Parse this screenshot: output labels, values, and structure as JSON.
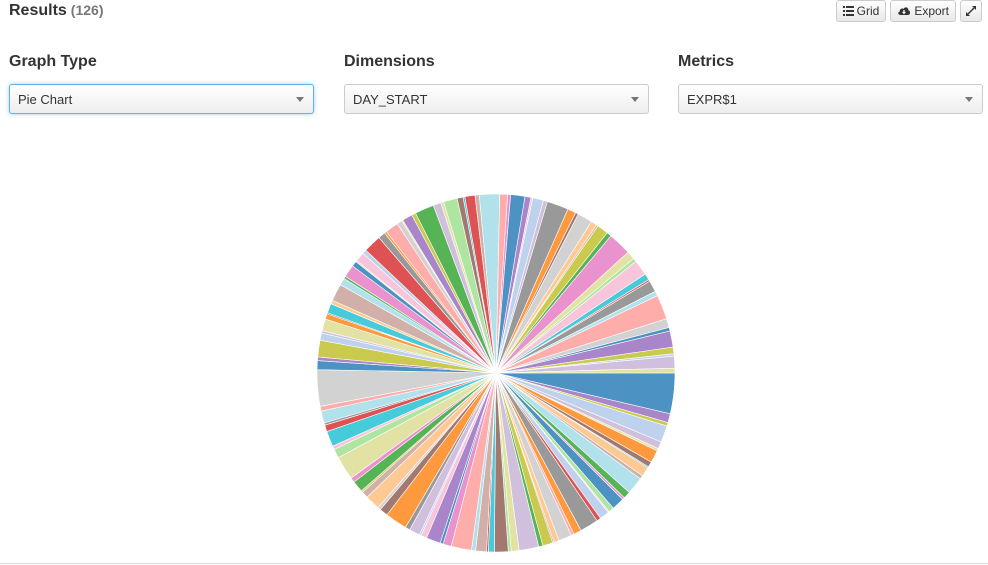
{
  "header": {
    "title": "Results",
    "count": "(126)"
  },
  "toolbar": {
    "grid_label": "Grid",
    "export_label": "Export",
    "grid_icon": "list-icon",
    "export_icon": "cloud-download-icon",
    "expand_icon": "expand-icon"
  },
  "controls": {
    "graph_type": {
      "label": "Graph Type",
      "value": "Pie Chart"
    },
    "dimensions": {
      "label": "Dimensions",
      "value": "DAY_START"
    },
    "metrics": {
      "label": "Metrics",
      "value": "EXPR$1"
    }
  },
  "colors": {
    "active_border": "#66afe9"
  },
  "chart_data": {
    "type": "pie",
    "slice_count": 126,
    "palette": [
      "#1f77b4",
      "#aec7e8",
      "#ff7f0e",
      "#ffbb78",
      "#2ca02c",
      "#98df8a",
      "#d62728",
      "#ff9896",
      "#9467bd",
      "#c5b0d5",
      "#8c564b",
      "#c49c94",
      "#e377c2",
      "#f7b6d2",
      "#7f7f7f",
      "#c7c7c7",
      "#bcbd22",
      "#dbdb8d",
      "#17becf",
      "#9edae5"
    ],
    "values": [
      6.8,
      6.1,
      4.1,
      4.0,
      3.9,
      3.7,
      3.6,
      3.4,
      3.4,
      3.3,
      3.2,
      3.1,
      3.0,
      2.9,
      2.9,
      2.8,
      2.8,
      2.7,
      2.6,
      2.6,
      2.5,
      2.5,
      2.4,
      2.4,
      2.3,
      2.3,
      2.2,
      2.2,
      2.1,
      2.1,
      2.1,
      2.0,
      2.0,
      2.0,
      1.9,
      1.9,
      1.9,
      1.8,
      1.8,
      1.8,
      1.7,
      1.7,
      1.7,
      1.6,
      1.6,
      1.6,
      1.6,
      1.5,
      1.5,
      1.5,
      1.5,
      1.4,
      1.4,
      1.4,
      1.4,
      1.3,
      1.3,
      1.3,
      1.3,
      1.2,
      1.2,
      1.2,
      1.2,
      1.2,
      1.1,
      1.1,
      1.1,
      1.1,
      1.0,
      1.0,
      1.0,
      1.0,
      1.0,
      0.9,
      0.9,
      0.9,
      0.9,
      0.9,
      0.9,
      0.8,
      0.8,
      0.8,
      0.8,
      0.8,
      0.8,
      0.7,
      0.7,
      0.7,
      0.7,
      0.7,
      0.7,
      0.7,
      0.6,
      0.6,
      0.6,
      0.6,
      0.6,
      0.6,
      0.6,
      0.5,
      0.5,
      0.5,
      0.5,
      0.5,
      0.5,
      0.5,
      0.4,
      0.4,
      0.4,
      0.4,
      0.4,
      0.4,
      0.4,
      0.3,
      0.3,
      0.3,
      0.3,
      0.3,
      0.3,
      0.3,
      0.2,
      0.2,
      0.2,
      0.2,
      0.2,
      0.2
    ]
  }
}
